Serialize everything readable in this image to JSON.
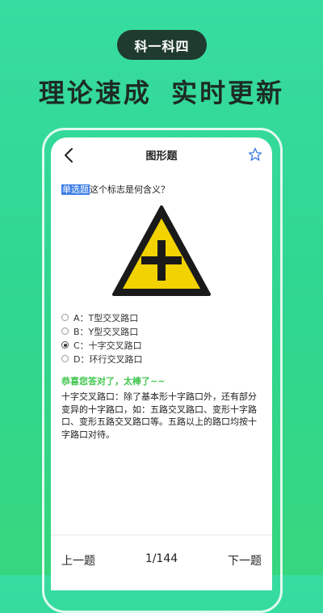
{
  "promo": {
    "badge": "科一科四",
    "headline": "理论速成  实时更新"
  },
  "topbar": {
    "title": "图形题",
    "back_icon": "chevron-left-icon",
    "favorite_icon": "star-outline-icon"
  },
  "question": {
    "type": "单选题",
    "text": "这个标志是何含义？",
    "sign_icon": "crossroads-warning-sign"
  },
  "options": [
    {
      "label": "A：T型交叉路口",
      "selected": false
    },
    {
      "label": "B：Y型交叉路口",
      "selected": false
    },
    {
      "label": "C：十字交叉路口",
      "selected": true
    },
    {
      "label": "D：环行交叉路口",
      "selected": false
    }
  ],
  "result": {
    "message": "恭喜您答对了，太棒了~~",
    "explanation": "十字交叉路口：除了基本形十字路口外，还有部分变异的十字路口，如：五路交叉路口、变形十字路口、变形五路交叉路口等。五路以上的路口均按十字路口对待。"
  },
  "nav": {
    "prev_label": "上一题",
    "page": "1/144",
    "next_label": "下一题"
  },
  "colors": {
    "accent_green": "#41c64f",
    "sign_yellow": "#f2d200",
    "highlight_blue": "#3d7ee6"
  }
}
